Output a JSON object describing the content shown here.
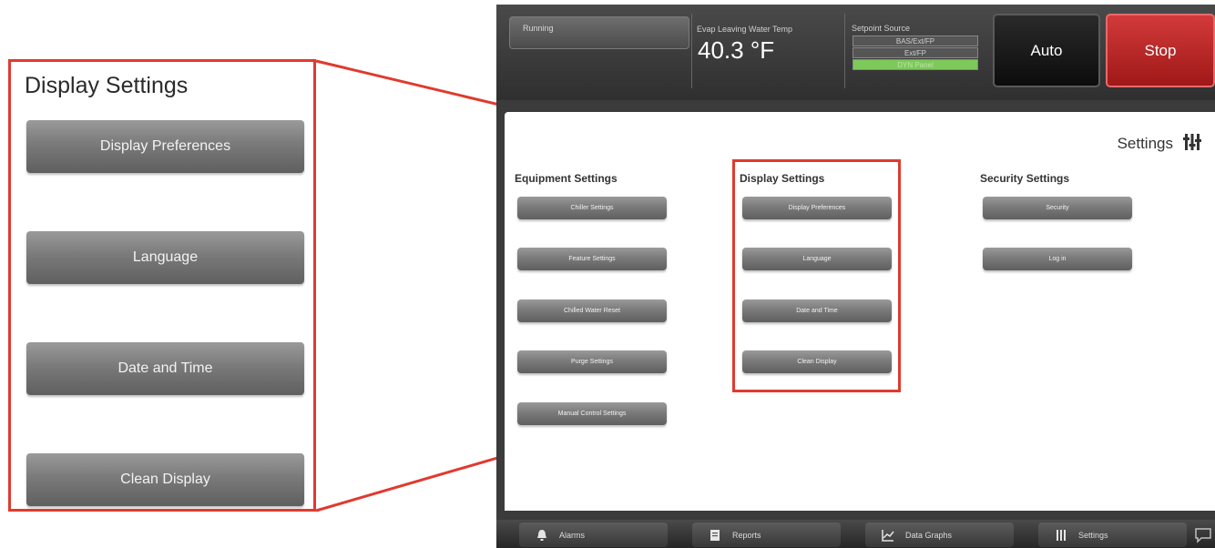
{
  "zoom": {
    "title": "Display Settings",
    "buttons": [
      "Display Preferences",
      "Language",
      "Date and Time",
      "Clean Display"
    ]
  },
  "status": {
    "state": "Running",
    "temp_label": "Evap Leaving Water Temp",
    "temp_value": "40.3 °F",
    "setpoint_label": "Setpoint Source",
    "setpoint_options": [
      "BAS/Ext/FP",
      "Ext/FP",
      "DYN Panel"
    ],
    "auto_label": "Auto",
    "stop_label": "Stop"
  },
  "page": {
    "title": "Settings"
  },
  "sections": {
    "equipment": {
      "heading": "Equipment Settings",
      "buttons": [
        "Chiller Settings",
        "Feature Settings",
        "Chilled Water Reset",
        "Purge Settings",
        "Manual Control Settings"
      ]
    },
    "display": {
      "heading": "Display Settings",
      "buttons": [
        "Display Preferences",
        "Language",
        "Date and Time",
        "Clean Display"
      ]
    },
    "security": {
      "heading": "Security Settings",
      "buttons": [
        "Security",
        "Log in"
      ]
    }
  },
  "bottom_nav": [
    "Alarms",
    "Reports",
    "Data Graphs",
    "Settings"
  ],
  "colors": {
    "callout": "#e03a2f",
    "stop": "#b82222",
    "setpoint_active": "#7dc95a"
  },
  "icons": [
    "back-arrow-icon",
    "home-icon",
    "settings-sliders-icon",
    "bell-icon",
    "report-icon",
    "graph-icon",
    "chat-icon"
  ]
}
